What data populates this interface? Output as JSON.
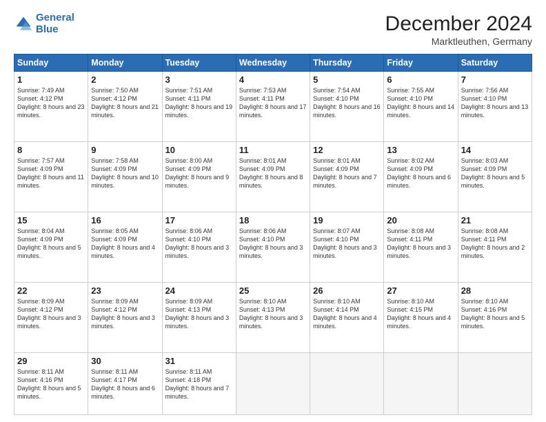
{
  "header": {
    "logo_line1": "General",
    "logo_line2": "Blue",
    "month": "December 2024",
    "location": "Marktleuthen, Germany"
  },
  "weekdays": [
    "Sunday",
    "Monday",
    "Tuesday",
    "Wednesday",
    "Thursday",
    "Friday",
    "Saturday"
  ],
  "weeks": [
    [
      {
        "day": "1",
        "rise": "Sunrise: 7:49 AM",
        "set": "Sunset: 4:12 PM",
        "light": "Daylight: 8 hours and 23 minutes."
      },
      {
        "day": "2",
        "rise": "Sunrise: 7:50 AM",
        "set": "Sunset: 4:12 PM",
        "light": "Daylight: 8 hours and 21 minutes."
      },
      {
        "day": "3",
        "rise": "Sunrise: 7:51 AM",
        "set": "Sunset: 4:11 PM",
        "light": "Daylight: 8 hours and 19 minutes."
      },
      {
        "day": "4",
        "rise": "Sunrise: 7:53 AM",
        "set": "Sunset: 4:11 PM",
        "light": "Daylight: 8 hours and 17 minutes."
      },
      {
        "day": "5",
        "rise": "Sunrise: 7:54 AM",
        "set": "Sunset: 4:10 PM",
        "light": "Daylight: 8 hours and 16 minutes."
      },
      {
        "day": "6",
        "rise": "Sunrise: 7:55 AM",
        "set": "Sunset: 4:10 PM",
        "light": "Daylight: 8 hours and 14 minutes."
      },
      {
        "day": "7",
        "rise": "Sunrise: 7:56 AM",
        "set": "Sunset: 4:10 PM",
        "light": "Daylight: 8 hours and 13 minutes."
      }
    ],
    [
      {
        "day": "8",
        "rise": "Sunrise: 7:57 AM",
        "set": "Sunset: 4:09 PM",
        "light": "Daylight: 8 hours and 11 minutes."
      },
      {
        "day": "9",
        "rise": "Sunrise: 7:58 AM",
        "set": "Sunset: 4:09 PM",
        "light": "Daylight: 8 hours and 10 minutes."
      },
      {
        "day": "10",
        "rise": "Sunrise: 8:00 AM",
        "set": "Sunset: 4:09 PM",
        "light": "Daylight: 8 hours and 9 minutes."
      },
      {
        "day": "11",
        "rise": "Sunrise: 8:01 AM",
        "set": "Sunset: 4:09 PM",
        "light": "Daylight: 8 hours and 8 minutes."
      },
      {
        "day": "12",
        "rise": "Sunrise: 8:01 AM",
        "set": "Sunset: 4:09 PM",
        "light": "Daylight: 8 hours and 7 minutes."
      },
      {
        "day": "13",
        "rise": "Sunrise: 8:02 AM",
        "set": "Sunset: 4:09 PM",
        "light": "Daylight: 8 hours and 6 minutes."
      },
      {
        "day": "14",
        "rise": "Sunrise: 8:03 AM",
        "set": "Sunset: 4:09 PM",
        "light": "Daylight: 8 hours and 5 minutes."
      }
    ],
    [
      {
        "day": "15",
        "rise": "Sunrise: 8:04 AM",
        "set": "Sunset: 4:09 PM",
        "light": "Daylight: 8 hours and 5 minutes."
      },
      {
        "day": "16",
        "rise": "Sunrise: 8:05 AM",
        "set": "Sunset: 4:09 PM",
        "light": "Daylight: 8 hours and 4 minutes."
      },
      {
        "day": "17",
        "rise": "Sunrise: 8:06 AM",
        "set": "Sunset: 4:10 PM",
        "light": "Daylight: 8 hours and 3 minutes."
      },
      {
        "day": "18",
        "rise": "Sunrise: 8:06 AM",
        "set": "Sunset: 4:10 PM",
        "light": "Daylight: 8 hours and 3 minutes."
      },
      {
        "day": "19",
        "rise": "Sunrise: 8:07 AM",
        "set": "Sunset: 4:10 PM",
        "light": "Daylight: 8 hours and 3 minutes."
      },
      {
        "day": "20",
        "rise": "Sunrise: 8:08 AM",
        "set": "Sunset: 4:11 PM",
        "light": "Daylight: 8 hours and 3 minutes."
      },
      {
        "day": "21",
        "rise": "Sunrise: 8:08 AM",
        "set": "Sunset: 4:11 PM",
        "light": "Daylight: 8 hours and 2 minutes."
      }
    ],
    [
      {
        "day": "22",
        "rise": "Sunrise: 8:09 AM",
        "set": "Sunset: 4:12 PM",
        "light": "Daylight: 8 hours and 3 minutes."
      },
      {
        "day": "23",
        "rise": "Sunrise: 8:09 AM",
        "set": "Sunset: 4:12 PM",
        "light": "Daylight: 8 hours and 3 minutes."
      },
      {
        "day": "24",
        "rise": "Sunrise: 8:09 AM",
        "set": "Sunset: 4:13 PM",
        "light": "Daylight: 8 hours and 3 minutes."
      },
      {
        "day": "25",
        "rise": "Sunrise: 8:10 AM",
        "set": "Sunset: 4:13 PM",
        "light": "Daylight: 8 hours and 3 minutes."
      },
      {
        "day": "26",
        "rise": "Sunrise: 8:10 AM",
        "set": "Sunset: 4:14 PM",
        "light": "Daylight: 8 hours and 4 minutes."
      },
      {
        "day": "27",
        "rise": "Sunrise: 8:10 AM",
        "set": "Sunset: 4:15 PM",
        "light": "Daylight: 8 hours and 4 minutes."
      },
      {
        "day": "28",
        "rise": "Sunrise: 8:10 AM",
        "set": "Sunset: 4:16 PM",
        "light": "Daylight: 8 hours and 5 minutes."
      }
    ],
    [
      {
        "day": "29",
        "rise": "Sunrise: 8:11 AM",
        "set": "Sunset: 4:16 PM",
        "light": "Daylight: 8 hours and 5 minutes."
      },
      {
        "day": "30",
        "rise": "Sunrise: 8:11 AM",
        "set": "Sunset: 4:17 PM",
        "light": "Daylight: 8 hours and 6 minutes."
      },
      {
        "day": "31",
        "rise": "Sunrise: 8:11 AM",
        "set": "Sunset: 4:18 PM",
        "light": "Daylight: 8 hours and 7 minutes."
      },
      null,
      null,
      null,
      null
    ]
  ]
}
